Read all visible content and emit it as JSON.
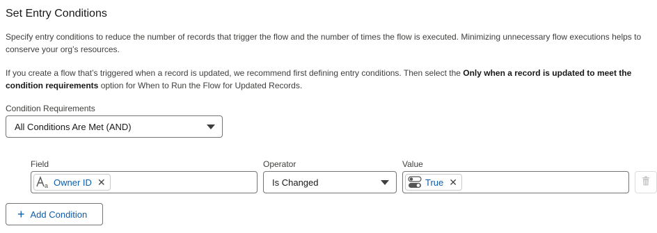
{
  "section": {
    "title": "Set Entry Conditions",
    "para1": "Specify entry conditions to reduce the number of records that trigger the flow and the number of times the flow is executed. Minimizing unnecessary flow executions helps to conserve your org’s resources.",
    "para2_prefix": "If you create a flow that’s triggered when a record is updated, we recommend first defining entry conditions. Then select the ",
    "para2_bold": "Only when a record is updated to meet the condition requirements",
    "para2_suffix": " option for When to Run the Flow for Updated Records."
  },
  "condition_requirements": {
    "label": "Condition Requirements",
    "value": "All Conditions Are Met (AND)"
  },
  "condition_row": {
    "field_label": "Field",
    "field_value": "Owner ID",
    "field_icon": "text-field-icon",
    "operator_label": "Operator",
    "operator_value": "Is Changed",
    "value_label": "Value",
    "value_value": "True",
    "value_icon": "toggle-icon",
    "remove_icon": "close-icon",
    "delete_icon": "trash-icon"
  },
  "add_condition": {
    "label": "Add Condition",
    "icon": "plus-icon"
  },
  "colors": {
    "link_blue": "#0b5cab",
    "border": "#747474",
    "text": "#181818",
    "muted": "#3e3e3c"
  }
}
